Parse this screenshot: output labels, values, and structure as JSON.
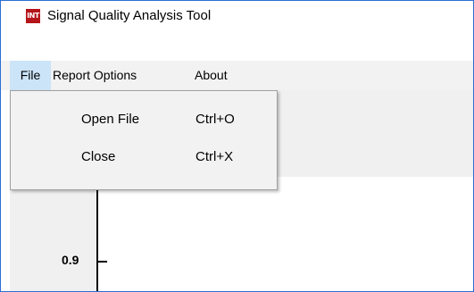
{
  "window": {
    "title": "Signal Quality Analysis Tool",
    "icon": "app-logo-icon",
    "icon_text": "INT",
    "accent_color": "#2b6fd6"
  },
  "menubar": {
    "items": [
      {
        "label": "File",
        "active": true
      },
      {
        "label": "Report Options"
      },
      {
        "label": "About"
      }
    ]
  },
  "file_menu": {
    "items": [
      {
        "label": "Open File",
        "shortcut": "Ctrl+O"
      },
      {
        "label": "Close",
        "shortcut": "Ctrl+X"
      }
    ]
  },
  "plot": {
    "y_tick_label": "0.9"
  }
}
